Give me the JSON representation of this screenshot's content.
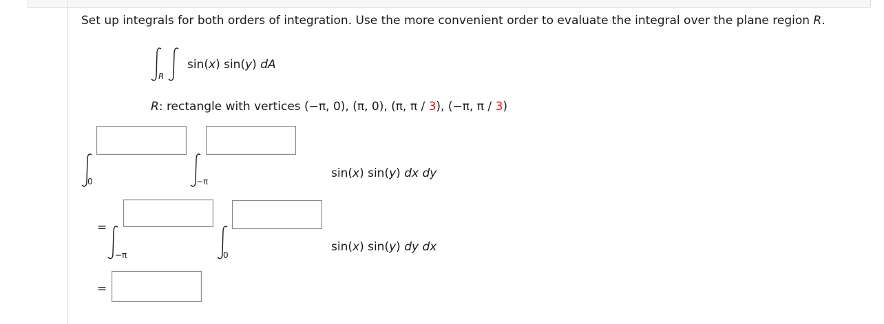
{
  "problem": {
    "instruction_main": "Set up integrals for both orders of integration. Use the more convenient order to evaluate the integral over the plane region ",
    "instruction_var": "R",
    "instruction_end": "."
  },
  "integral": {
    "region_sub": "R",
    "integrand_a": "sin(",
    "integrand_x": "x",
    "integrand_b": ") sin(",
    "integrand_y": "y",
    "integrand_c": ") ",
    "integrand_d": "dA"
  },
  "region": {
    "var": "R",
    "text": ": rectangle with vertices (−π, 0), (π, 0), (π, π / ",
    "three_a": "3",
    "middle": "), (−π, π / ",
    "three_b": "3",
    "close": ")"
  },
  "order1": {
    "outer_lower": "0",
    "inner_lower": "−π",
    "integrand_a": "sin(",
    "integrand_x": "x",
    "integrand_b": ") sin(",
    "integrand_y": "y",
    "integrand_c": ") ",
    "integrand_d": "dx dy"
  },
  "order2": {
    "equals": "=",
    "outer_lower": "−π",
    "inner_lower": "0",
    "integrand_a": "sin(",
    "integrand_x": "x",
    "integrand_b": ") sin(",
    "integrand_y": "y",
    "integrand_c": ") ",
    "integrand_d": "dy dx"
  },
  "result": {
    "equals": "="
  },
  "colors": {
    "highlight": "#e0141e",
    "box_border": "#8a8a8a"
  }
}
